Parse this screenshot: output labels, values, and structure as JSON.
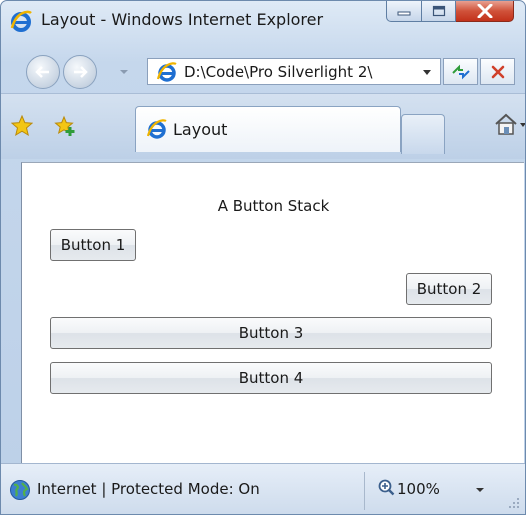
{
  "window": {
    "title": "Layout - Windows Internet Explorer"
  },
  "address_bar": {
    "url": "D:\\Code\\Pro Silverlight 2\\"
  },
  "tab": {
    "label": "Layout"
  },
  "content": {
    "heading": "A Button Stack",
    "buttons": [
      {
        "label": "Button 1"
      },
      {
        "label": "Button 2"
      },
      {
        "label": "Button 3"
      },
      {
        "label": "Button 4"
      }
    ]
  },
  "status_bar": {
    "zone": "Internet | Protected Mode: On",
    "zoom": "100%"
  },
  "colors": {
    "close_button": "#c2311a",
    "window_frame": "#bcd0e8",
    "ie_logo": "#1f6fd1"
  },
  "icons": [
    "ie-logo-icon",
    "minimize-icon",
    "maximize-icon",
    "close-icon",
    "back-icon",
    "forward-icon",
    "refresh-icon",
    "stop-icon",
    "favorites-star-icon",
    "add-favorites-icon",
    "home-icon",
    "globe-icon",
    "zoom-icon",
    "resize-grip-icon"
  ]
}
